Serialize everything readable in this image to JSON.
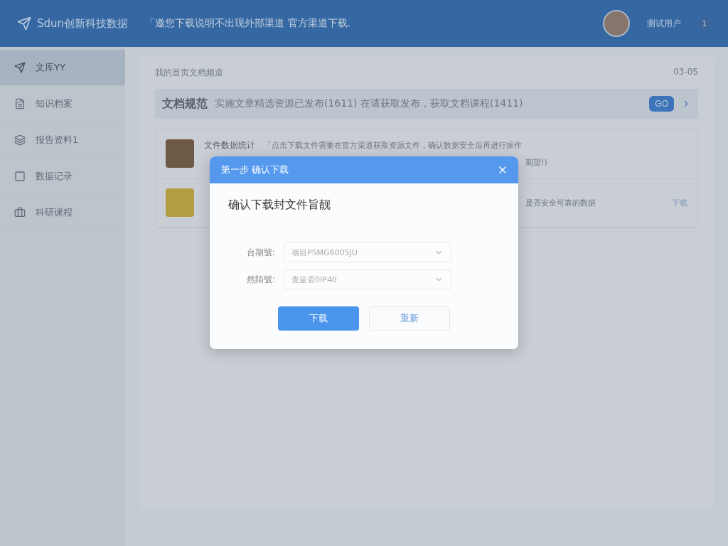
{
  "header": {
    "logo_text": "Sdun创新科技数据",
    "notice": "「邀您下载说明不出现外部渠道  官方渠道下载.",
    "user_name": "测试用户",
    "badge": "1"
  },
  "sidebar": {
    "items": [
      {
        "label": "文库YY",
        "selected": true
      },
      {
        "label": "知识档案",
        "selected": false
      },
      {
        "label": "报告资料1",
        "selected": false
      },
      {
        "label": "数据记录",
        "selected": false
      },
      {
        "label": "科研课程",
        "selected": false
      }
    ]
  },
  "content": {
    "breadcrumb": "我的首页文档频道",
    "date": "03-05",
    "banner": {
      "title": "文档规范",
      "text": "实施文章精选资源已发布(1611)  在请获取发布，获取文档课程(1411)",
      "button": "GO"
    },
    "files": [
      {
        "kind": "grid",
        "title": "文件数据统计",
        "desc": "「点击下载文件需要在官方渠道获取资源文件，确认数据安全后再进行操作",
        "note": "期望!)"
      },
      {
        "kind": "folder",
        "desc": "是否安全可靠的数据",
        "action": "下载"
      }
    ]
  },
  "dialog": {
    "title": "第一步  确认下载",
    "heading": "确认下载封文件旨靓",
    "fields": [
      {
        "label": "台期號:",
        "value": "项目PSMG6005JU"
      },
      {
        "label": "然陌號:",
        "value": "查蓝否0IP40"
      }
    ],
    "buttons": [
      {
        "label": "下载",
        "kind": "primary"
      },
      {
        "label": "重新",
        "kind": "secondary"
      }
    ]
  }
}
